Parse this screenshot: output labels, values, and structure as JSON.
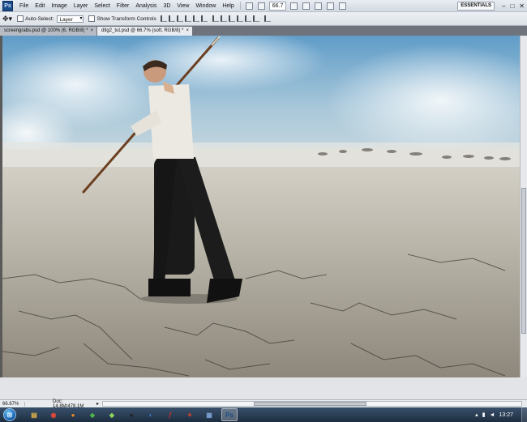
{
  "app": {
    "logo": "Ps"
  },
  "menubar": {
    "items": [
      "File",
      "Edit",
      "Image",
      "Layer",
      "Select",
      "Filter",
      "Analysis",
      "3D",
      "View",
      "Window",
      "Help"
    ],
    "zoom": "66.7",
    "workspace": "ESSENTIALS",
    "window_controls": [
      "–",
      "□",
      "✕"
    ]
  },
  "options": {
    "auto_select_label": "Auto-Select:",
    "auto_select_value": "Layer",
    "transform_label": "Show Transform Controls"
  },
  "tabs": [
    {
      "label": "screengrabs.psd @ 100% (6, RGB/8) *",
      "close": "×"
    },
    {
      "label": "dtlg2_tut.psd @ 66.7% (soft, RGB/8) *",
      "close": "×"
    }
  ],
  "status": {
    "zoom": "66.67%",
    "doc_info": "Doc: 14.8M/478.1M",
    "arrow": "▸"
  },
  "taskbar": {
    "start": "⊞",
    "apps": [
      {
        "icon": "folder-icon",
        "glyph": "▤",
        "color": "#e8b84a"
      },
      {
        "icon": "chrome-icon",
        "glyph": "◉",
        "color": "#e04a3a"
      },
      {
        "icon": "firefox-icon",
        "glyph": "●",
        "color": "#f08a2a"
      },
      {
        "icon": "utility-icon",
        "glyph": "◆",
        "color": "#4cb34a"
      },
      {
        "icon": "app-icon",
        "glyph": "◆",
        "color": "#8fd35a"
      },
      {
        "icon": "media-icon",
        "glyph": "●",
        "color": "#222222"
      },
      {
        "icon": "explorer-icon",
        "glyph": "◐",
        "color": "#3a7fd0"
      },
      {
        "icon": "flash-icon",
        "glyph": "ƒ",
        "color": "#c0302a"
      },
      {
        "icon": "fireworks-icon",
        "glyph": "✦",
        "color": "#d0452b"
      },
      {
        "icon": "notepad-icon",
        "glyph": "▦",
        "color": "#7a9fd0"
      },
      {
        "icon": "photoshop-icon",
        "glyph": "Ps",
        "color": "#1b4c8a",
        "active": true
      }
    ],
    "clock": "13:27"
  }
}
